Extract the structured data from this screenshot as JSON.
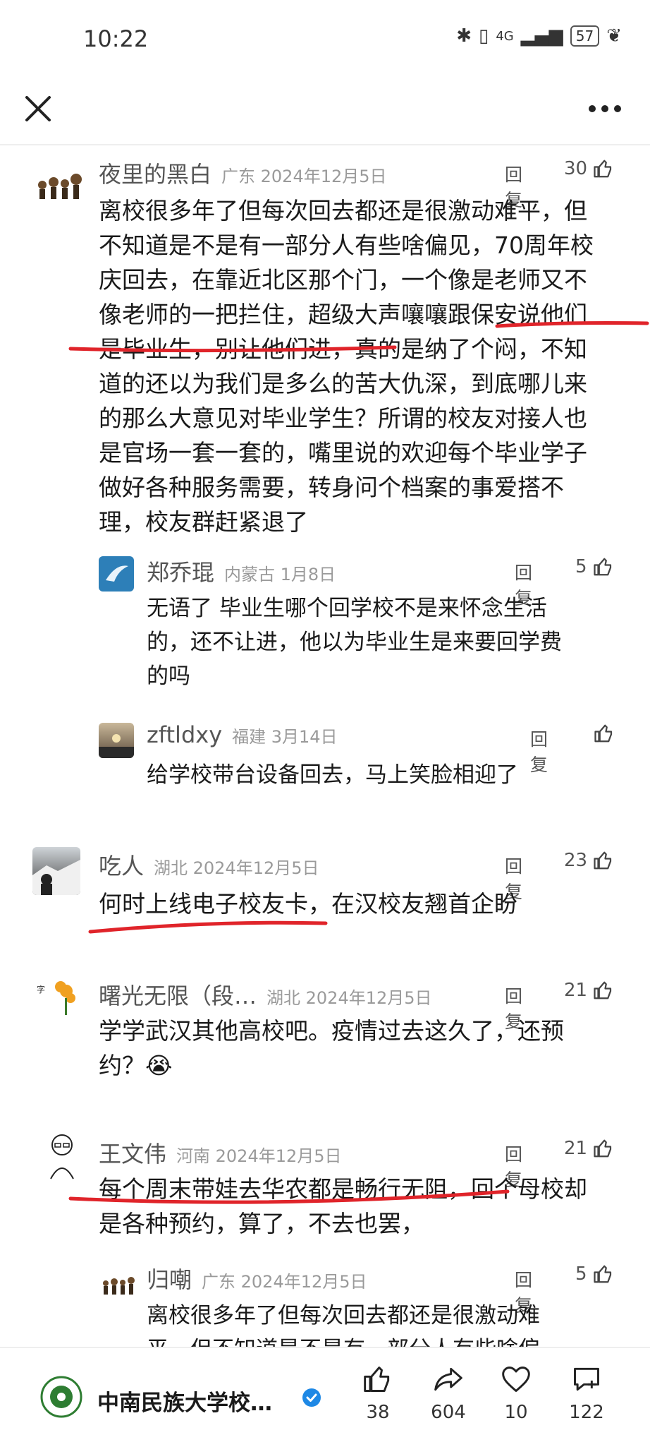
{
  "status": {
    "time": "10:22",
    "battery": "57",
    "signal": "4G"
  },
  "comments": [
    {
      "name": "夜里的黑白",
      "location": "广东 2024年12月5日",
      "reply": "回复",
      "likes": "30",
      "lines": [
        "离校很多年了但每次回去都还是很激动难平，但",
        "不知道是不是有一部分人有些啥偏见，70周年校",
        "庆回去，在靠近北区那个门，一个像是老师又不",
        "像老师的一把拦住，超级大声嚷嚷跟保安说他们",
        "是毕业生，别让他们进，真的是纳了个闷，不知",
        "道的还以为我们是多么的苦大仇深，到底哪儿来",
        "的那么大意见对毕业学生？所谓的校友对接人也",
        "是官场一套一套的，嘴里说的欢迎每个毕业学子",
        "做好各种服务需要，转身问个档案的事爱搭不",
        "理，校友群赶紧退了"
      ]
    },
    {
      "name": "郑乔琨",
      "location": "内蒙古 1月8日",
      "reply": "回复",
      "likes": "5",
      "lines": [
        "无语了  毕业生哪个回学校不是来怀念生活",
        "的，还不让进，他以为毕业生是来要回学费",
        "的吗"
      ]
    },
    {
      "name": "zftldxy",
      "location": "福建 3月14日",
      "reply": "回复",
      "likes": "",
      "lines": [
        "给学校带台设备回去，马上笑脸相迎了"
      ]
    },
    {
      "name": "吃人",
      "location": "湖北 2024年12月5日",
      "reply": "回复",
      "likes": "23",
      "lines": [
        "何时上线电子校友卡，在汉校友翘首企盼"
      ]
    },
    {
      "name": "曙光无限（段…",
      "location": "湖北 2024年12月5日",
      "reply": "回复",
      "likes": "21",
      "lines": [
        "学学武汉其他高校吧。疫情过去这久了，还预",
        "约？😭"
      ]
    },
    {
      "name": "王文伟",
      "location": "河南 2024年12月5日",
      "reply": "回复",
      "likes": "21",
      "lines": [
        "每个周末带娃去华农都是畅行无阻，回个母校却",
        "是各种预约，算了，不去也罢，"
      ]
    },
    {
      "name": "归嘲",
      "location": "广东 2024年12月5日",
      "reply": "回复",
      "likes": "5",
      "lines": [
        "离校很多年了但每次回去都还是很激动难",
        "平，但不知道是不是有一部分人有些啥偏"
      ]
    }
  ],
  "bottom": {
    "org_name": "中南民族大学校…",
    "like_count": "38",
    "share_count": "604",
    "fav_count": "10",
    "comment_count": "122"
  },
  "colors": {
    "accent_blue": "#1e88e5",
    "annotation_red": "#e0242a"
  }
}
